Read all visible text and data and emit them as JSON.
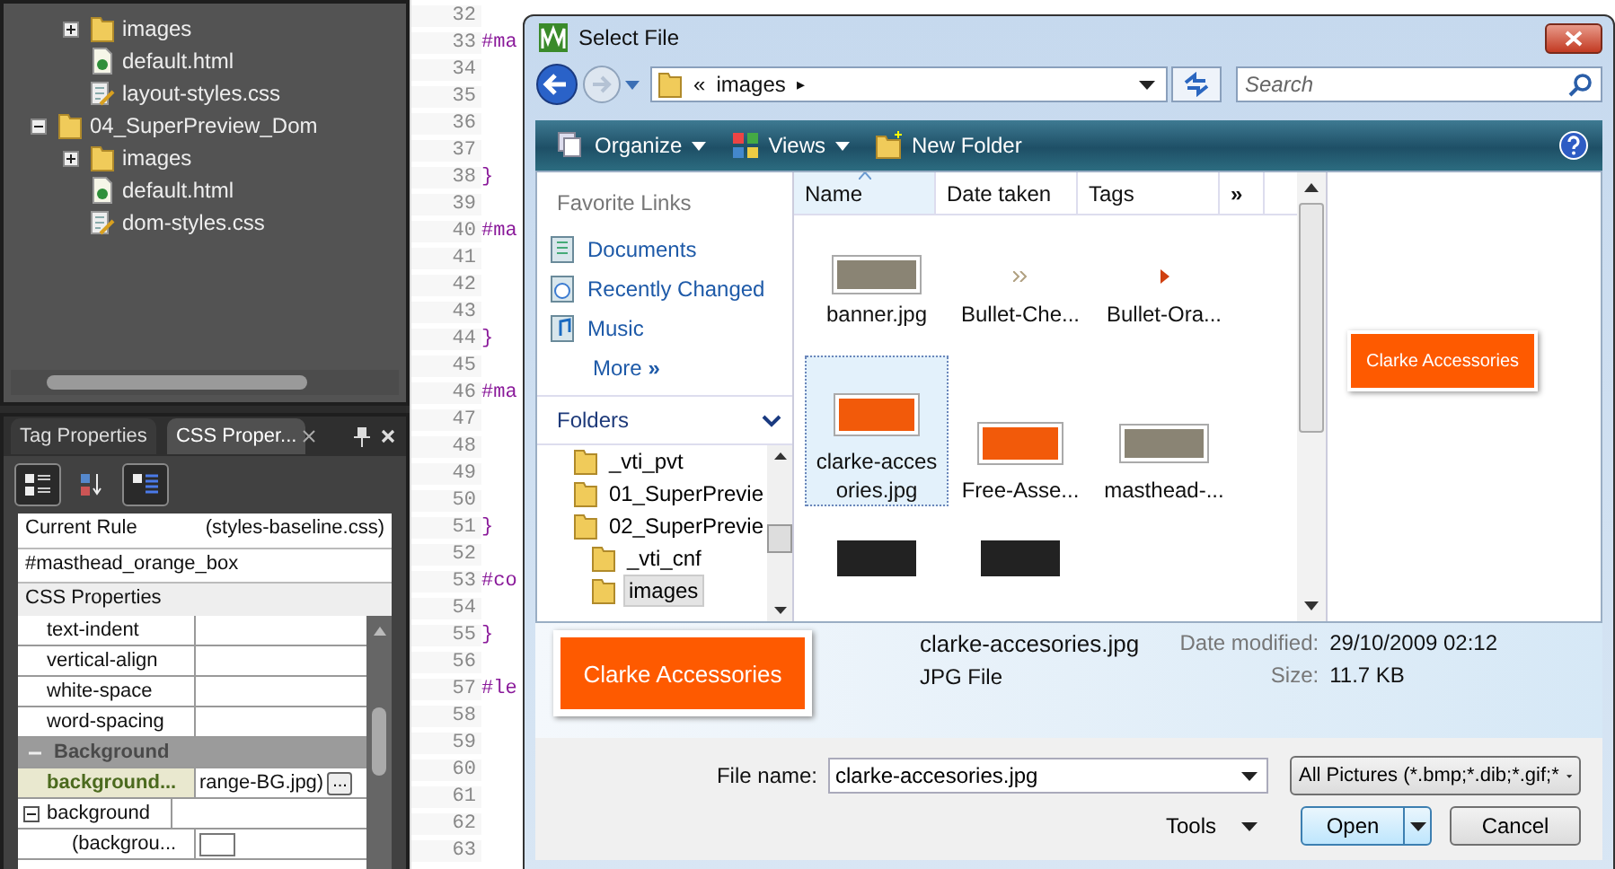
{
  "explorer": {
    "loose_items": [
      {
        "name": "images",
        "kind": "folder",
        "expanded": false
      },
      {
        "name": "default.html",
        "kind": "html"
      },
      {
        "name": "layout-styles.css",
        "kind": "css"
      }
    ],
    "folders": [
      {
        "name": "04_SuperPreview_Dom",
        "expanded": true,
        "children": [
          {
            "name": "images",
            "kind": "folder",
            "expanded": false
          },
          {
            "name": "default.html",
            "kind": "html"
          },
          {
            "name": "dom-styles.css",
            "kind": "css"
          }
        ]
      }
    ]
  },
  "properties_panel": {
    "tabs": [
      {
        "label": "Tag Properties",
        "selected": false
      },
      {
        "label": "CSS Proper...",
        "selected": true
      }
    ],
    "toolbar": [
      {
        "kind": "categorized",
        "pressed": true
      },
      {
        "kind": "sort",
        "pressed": false
      },
      {
        "kind": "list",
        "pressed": true
      }
    ],
    "current_rule": {
      "label": "Current Rule",
      "source": "(styles-baseline.css)",
      "selector": "#masthead_orange_box"
    },
    "section_label": "CSS Properties",
    "rows": [
      {
        "kind": "prop",
        "name": "text-indent"
      },
      {
        "kind": "prop",
        "name": "vertical-align"
      },
      {
        "kind": "prop",
        "name": "white-space"
      },
      {
        "kind": "prop",
        "name": "word-spacing"
      },
      {
        "kind": "category",
        "name": "Background",
        "expanded": true
      },
      {
        "kind": "applied",
        "name": "background...",
        "value": "range-BG.jpg)",
        "button": "..."
      },
      {
        "kind": "group",
        "name": "background",
        "expanded": true
      },
      {
        "kind": "swatch",
        "name": "(backgrou..."
      }
    ]
  },
  "editor": {
    "lines": [
      {
        "number": "32"
      },
      {
        "number": "33",
        "code": "#ma"
      },
      {
        "number": "34"
      },
      {
        "number": "35"
      },
      {
        "number": "36"
      },
      {
        "number": "37"
      },
      {
        "number": "38",
        "code": "}"
      },
      {
        "number": "39"
      },
      {
        "number": "40",
        "code": "#ma"
      },
      {
        "number": "41"
      },
      {
        "number": "42"
      },
      {
        "number": "43"
      },
      {
        "number": "44",
        "code": "}"
      },
      {
        "number": "45"
      },
      {
        "number": "46",
        "code": "#ma"
      },
      {
        "number": "47"
      },
      {
        "number": "48"
      },
      {
        "number": "49"
      },
      {
        "number": "50"
      },
      {
        "number": "51",
        "code": "}"
      },
      {
        "number": "52"
      },
      {
        "number": "53",
        "code": "#co"
      },
      {
        "number": "54"
      },
      {
        "number": "55",
        "code": "}"
      },
      {
        "number": "56"
      },
      {
        "number": "57",
        "code": "#le"
      },
      {
        "number": "58"
      },
      {
        "number": "59"
      },
      {
        "number": "60"
      },
      {
        "number": "61"
      },
      {
        "number": "62"
      },
      {
        "number": "63"
      }
    ]
  },
  "dialog": {
    "title": "Select File",
    "address": {
      "overflow": "«",
      "folder": "images",
      "separator": "▸"
    },
    "search": {
      "placeholder": "Search"
    },
    "toolbar": [
      {
        "kind": "organize",
        "label": "Organize"
      },
      {
        "kind": "views",
        "label": "Views"
      },
      {
        "kind": "new-folder",
        "label": "New Folder"
      }
    ],
    "favorite_links": {
      "heading": "Favorite Links",
      "items": [
        {
          "kind": "documents",
          "label": "Documents"
        },
        {
          "kind": "recent",
          "label": "Recently Changed"
        },
        {
          "kind": "music",
          "label": "Music"
        }
      ],
      "more": "More",
      "more_glyph": "»"
    },
    "folders": {
      "heading": "Folders",
      "items": [
        {
          "name": "_vti_pvt",
          "selected": false
        },
        {
          "name": "01_SuperPrevie",
          "selected": false
        },
        {
          "name": "02_SuperPrevie",
          "selected": false,
          "children": [
            {
              "name": "_vti_cnf",
              "selected": false
            },
            {
              "name": "images",
              "selected": true
            }
          ]
        }
      ]
    },
    "columns": [
      {
        "label": "Name",
        "sorted": true
      },
      {
        "label": "Date taken",
        "sorted": false
      },
      {
        "label": "Tags",
        "sorted": false
      }
    ],
    "columns_more": "»",
    "files": [
      {
        "name": "banner.jpg",
        "kind": "photo",
        "selected": false
      },
      {
        "name": "Bullet-Che...",
        "kind": "chevron",
        "selected": false
      },
      {
        "name": "Bullet-Ora...",
        "kind": "arrow",
        "selected": false
      },
      {
        "name": "clarke-acces ories.jpg",
        "kind": "banner",
        "selected": true
      },
      {
        "name": "Free-Asse...",
        "kind": "banner",
        "selected": false
      },
      {
        "name": "masthead-...",
        "kind": "photo",
        "selected": false
      }
    ],
    "preview_text": "Clarke Accessories",
    "details": {
      "thumbnail_text": "Clarke Accessories",
      "name": "clarke-accesories.jpg",
      "type": "JPG File",
      "fields": [
        {
          "label": "Date modified:",
          "value": "29/10/2009 02:12"
        },
        {
          "label": "Size:",
          "value": "11.7 KB"
        }
      ]
    },
    "file_name": {
      "label": "File name:",
      "value": "clarke-accesories.jpg"
    },
    "filter": "All Pictures (*.bmp;*.dib;*.gif;*",
    "tools": "Tools",
    "open": "Open",
    "cancel": "Cancel"
  }
}
